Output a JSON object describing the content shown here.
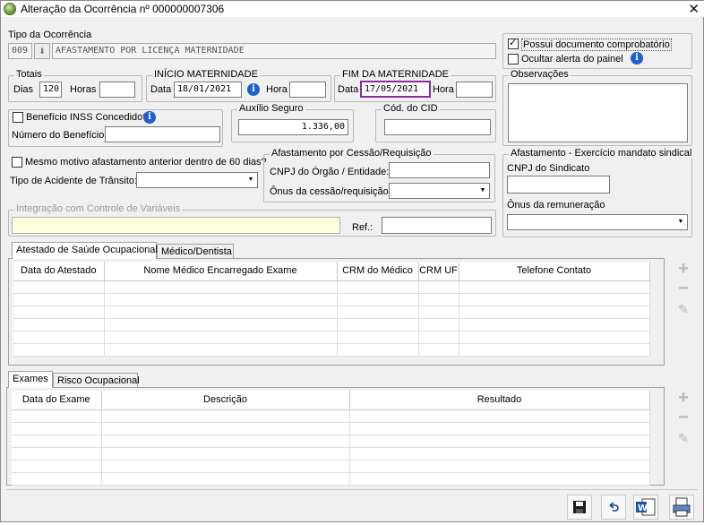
{
  "window": {
    "title": "Alteração da Ocorrência nº 000000007306",
    "close_glyph": "✕"
  },
  "tipo": {
    "label": "Tipo da Ocorrência",
    "code": "009",
    "description": "AFASTAMENTO POR LICENÇA MATERNIDADE"
  },
  "docs": {
    "possui_label": "Possui documento comprobatório",
    "possui_checked": true,
    "ocultar_label": "Ocultar alerta do painel",
    "ocultar_checked": false
  },
  "totais": {
    "group": "Totais",
    "dias_label": "Dias",
    "dias_value": "120",
    "horas_label": "Horas",
    "horas_value": ""
  },
  "inicio": {
    "group": "INÍCIO MATERNIDADE",
    "data_label": "Data",
    "data_value": "18/01/2021",
    "hora_label": "Hora",
    "hora_value": ""
  },
  "fim": {
    "group": "FIM DA MATERNIDADE",
    "data_label": "Data",
    "data_value": "17/05/2021",
    "hora_label": "Hora",
    "hora_value": ""
  },
  "observacoes": {
    "group": "Observações",
    "value": ""
  },
  "inss": {
    "label": "Benefício INSS Concedido?",
    "checked": false,
    "numero_label": "Número do Benefício:",
    "numero_value": ""
  },
  "auxilio": {
    "group": "Auxílio Seguro",
    "value": "1.336,00"
  },
  "cid": {
    "group": "Cód. do CID",
    "value": ""
  },
  "mesmo_motivo": {
    "label": "Mesmo motivo afastamento anterior dentro de 60 dias?",
    "checked": false
  },
  "acidente": {
    "label": "Tipo de Acidente de Trânsito:",
    "value": ""
  },
  "cessao": {
    "group": "Afastamento por Cessão/Requisição",
    "cnpj_label": "CNPJ do Órgão / Entidade:",
    "cnpj_value": "",
    "onus_label": "Ônus da cessão/requisição:",
    "onus_value": ""
  },
  "sindical": {
    "group": "Afastamento - Exercício mandato sindical",
    "cnpj_label": "CNPJ do Sindicato",
    "cnpj_value": "",
    "onus_label": "Ônus da remuneração",
    "onus_value": ""
  },
  "integracao": {
    "group": "Integração com Controle de Variáveis",
    "value": "",
    "ref_label": "Ref.:",
    "ref_value": ""
  },
  "tabs1": {
    "items": [
      "Atestado de Saúde Ocupacional",
      "Médico/Dentista"
    ],
    "columns": [
      "Data do Atestado",
      "Nome Médico Encarregado Exame",
      "CRM do Médico",
      "CRM UF",
      "Telefone Contato"
    ]
  },
  "tabs2": {
    "items": [
      "Exames",
      "Risco Ocupacional"
    ],
    "columns": [
      "Data do Exame",
      "Descrição",
      "Resultado"
    ]
  },
  "side_actions": {
    "add": "+",
    "remove": "−",
    "edit": "✎"
  },
  "icons": {
    "info": "i",
    "save": "save-icon",
    "undo": "undo-icon",
    "word": "word-doc-icon",
    "print": "print-preview-icon"
  },
  "colors": {
    "accent_purple": "#8a2aa0",
    "info_blue": "#1f5fcf",
    "yellow_field": "#ffffe0"
  }
}
